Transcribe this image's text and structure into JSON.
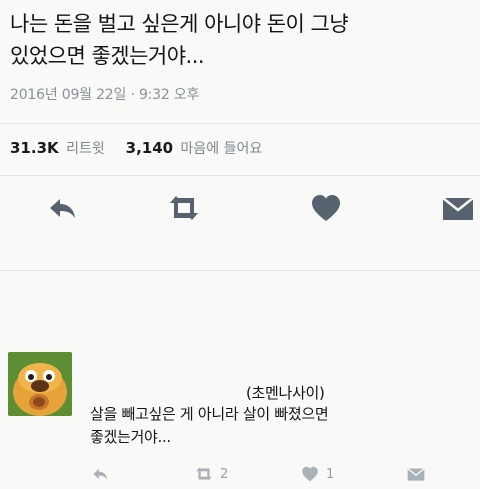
{
  "tweet": {
    "text_line1": "나는 돈을 벌고 싶은게 아니야 돈이 그냥",
    "text_line2": "있었으면 좋겠는거야...",
    "timestamp": "2016년 09월 22일 · 9:32 오후"
  },
  "stats": {
    "retweets_count": "31.3K",
    "retweets_label": "리트윗",
    "likes_count": "3,140",
    "likes_label": "마음에 들어요"
  },
  "actions": {
    "icons": [
      "reply-icon",
      "retweet-icon",
      "heart-icon",
      "message-icon"
    ],
    "color": "#56626d"
  },
  "reply": {
    "handle": "(초멘나사이)",
    "text_line1": "살을 빼고싶은 게 아니라 살이 빠졌으면",
    "text_line2": "좋겠는거야...",
    "retweet_count": "2",
    "like_count": "1",
    "icon_color": "#a9b0b6"
  }
}
